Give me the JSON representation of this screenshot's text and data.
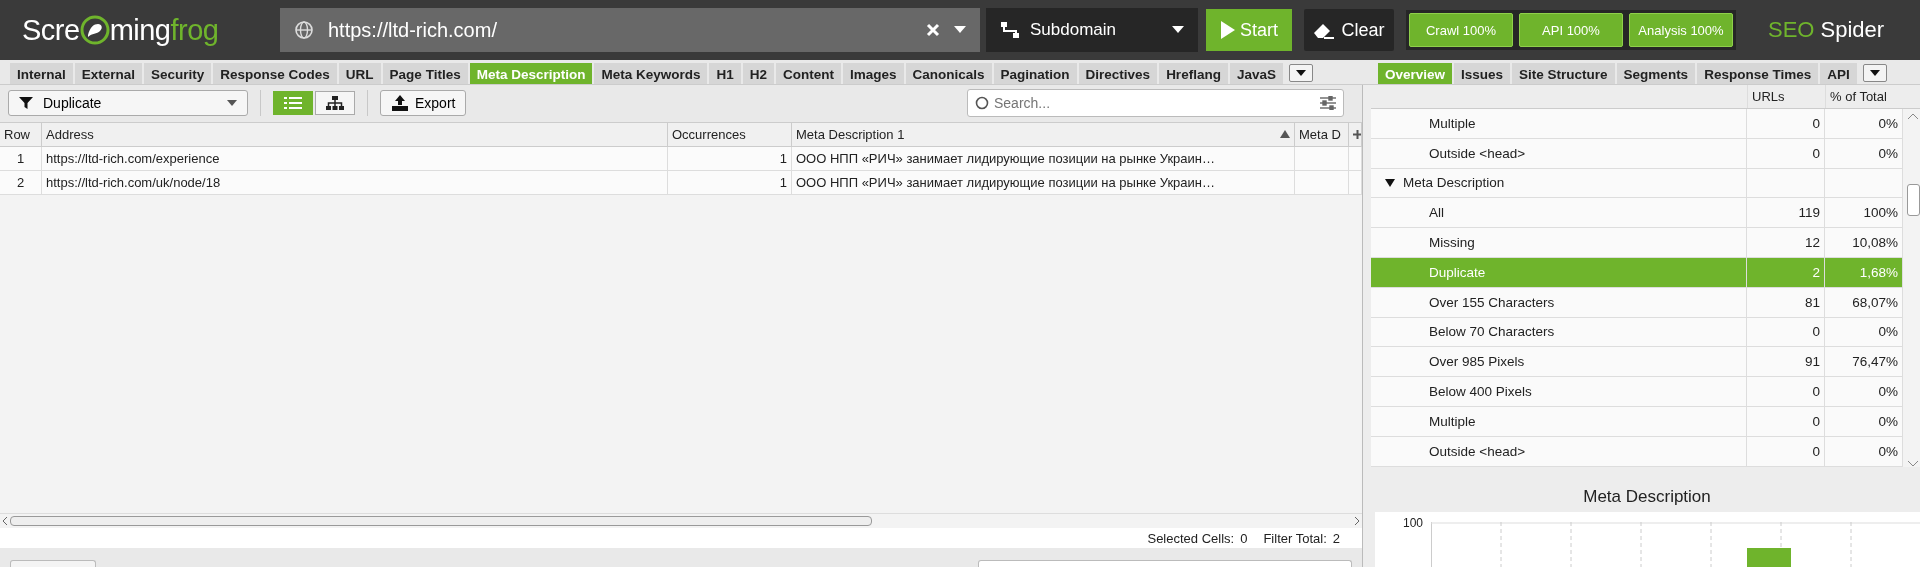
{
  "header": {
    "logo": {
      "start": "Scre",
      "middle": "ming",
      "end": "frog"
    },
    "url": "https://ltd-rich.com/",
    "mode": "Subdomain",
    "start": "Start",
    "clear": "Clear",
    "progress": [
      {
        "label": "Crawl 100%"
      },
      {
        "label": "API 100%"
      },
      {
        "label": "Analysis 100%"
      }
    ],
    "product": {
      "first": "SEO",
      "second": "Spider"
    }
  },
  "left_tabs": [
    {
      "label": "Internal",
      "selected": false
    },
    {
      "label": "External",
      "selected": false
    },
    {
      "label": "Security",
      "selected": false
    },
    {
      "label": "Response Codes",
      "selected": false
    },
    {
      "label": "URL",
      "selected": false
    },
    {
      "label": "Page Titles",
      "selected": false
    },
    {
      "label": "Meta Description",
      "selected": true
    },
    {
      "label": "Meta Keywords",
      "selected": false
    },
    {
      "label": "H1",
      "selected": false
    },
    {
      "label": "H2",
      "selected": false
    },
    {
      "label": "Content",
      "selected": false
    },
    {
      "label": "Images",
      "selected": false
    },
    {
      "label": "Canonicals",
      "selected": false
    },
    {
      "label": "Pagination",
      "selected": false
    },
    {
      "label": "Directives",
      "selected": false
    },
    {
      "label": "Hreflang",
      "selected": false
    },
    {
      "label": "JavaS",
      "selected": false
    }
  ],
  "right_tabs": [
    {
      "label": "Overview",
      "selected": true
    },
    {
      "label": "Issues",
      "selected": false
    },
    {
      "label": "Site Structure",
      "selected": false
    },
    {
      "label": "Segments",
      "selected": false
    },
    {
      "label": "Response Times",
      "selected": false
    },
    {
      "label": "API",
      "selected": false
    }
  ],
  "toolbar": {
    "filter": "Duplicate",
    "views": [
      {
        "kind": "list",
        "selected": true
      },
      {
        "kind": "tree",
        "selected": false
      }
    ],
    "export": "Export",
    "search": {
      "placeholder": "Search..."
    }
  },
  "table": {
    "columns": [
      {
        "label": "Row",
        "sorted": false
      },
      {
        "label": "Address",
        "sorted": false
      },
      {
        "label": "Occurrences",
        "sorted": false
      },
      {
        "label": "Meta Description 1",
        "sorted": true
      },
      {
        "label": "Meta D",
        "sorted": false
      }
    ],
    "rows": [
      [
        "1",
        "https://ltd-rich.com/experience",
        "1",
        "ООО НПП «РИЧ» занимает лидирующие позиции на рынке Украин…"
      ],
      [
        "2",
        "https://ltd-rich.com/uk/node/18",
        "1",
        "ООО НПП «РИЧ» занимает лидирующие позиции на рынке Украин…"
      ]
    ]
  },
  "status_bar": [
    {
      "label": "Selected Cells:",
      "value": "0"
    },
    {
      "label": "Filter Total:",
      "value": "2"
    }
  ],
  "overview": {
    "columns": [
      "URLs",
      "% of Total"
    ],
    "tree": [
      {
        "label": "Multiple",
        "urls": "0",
        "pct": "0%",
        "selected": false
      },
      {
        "label": "Outside <head>",
        "urls": "0",
        "pct": "0%",
        "selected": false
      },
      {
        "label": "Meta Description",
        "expanded": true,
        "children": [
          {
            "label": "All",
            "urls": "119",
            "pct": "100%",
            "selected": false
          },
          {
            "label": "Missing",
            "urls": "12",
            "pct": "10,08%",
            "selected": false
          },
          {
            "label": "Duplicate",
            "urls": "2",
            "pct": "1,68%",
            "selected": true
          },
          {
            "label": "Over 155 Characters",
            "urls": "81",
            "pct": "68,07%",
            "selected": false
          },
          {
            "label": "Below 70 Characters",
            "urls": "0",
            "pct": "0%",
            "selected": false
          },
          {
            "label": "Over 985 Pixels",
            "urls": "91",
            "pct": "76,47%",
            "selected": false
          },
          {
            "label": "Below 400 Pixels",
            "urls": "0",
            "pct": "0%",
            "selected": false
          },
          {
            "label": "Multiple",
            "urls": "0",
            "pct": "0%",
            "selected": false
          },
          {
            "label": "Outside <head>",
            "urls": "0",
            "pct": "0%",
            "selected": false
          }
        ]
      }
    ]
  },
  "chart": {
    "title": "Meta Description",
    "tick_label": "100"
  }
}
